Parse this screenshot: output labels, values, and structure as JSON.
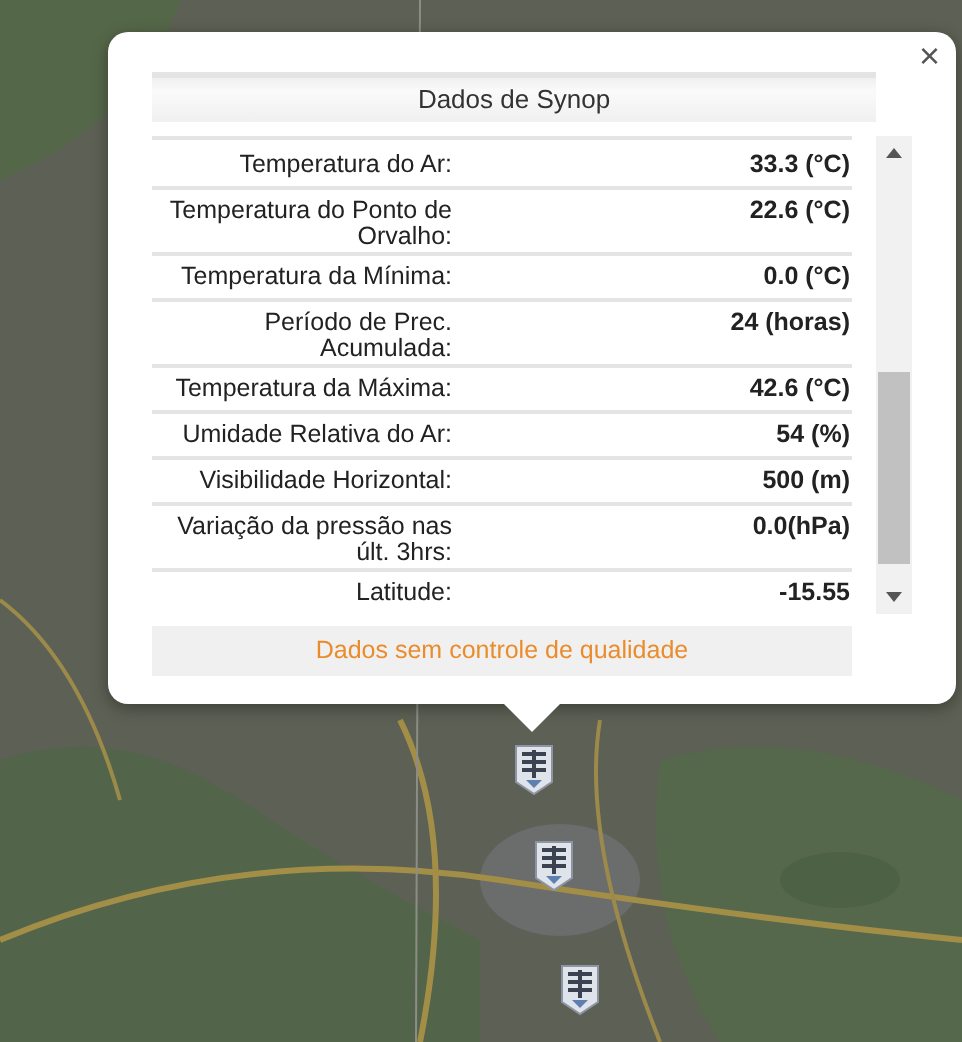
{
  "popup": {
    "close": "×",
    "title": "Dados de Synop",
    "rows": [
      {
        "label": "Temperatura do Ar:",
        "value": "33.3 (°C)"
      },
      {
        "label": "Temperatura do Ponto de Orvalho:",
        "value": "22.6 (°C)"
      },
      {
        "label": "Temperatura da Mínima:",
        "value": "0.0 (°C)"
      },
      {
        "label": "Período de Prec. Acumulada:",
        "value": "24 (horas)"
      },
      {
        "label": "Temperatura da Máxima:",
        "value": "42.6 (°C)"
      },
      {
        "label": "Umidade Relativa do Ar:",
        "value": "54 (%)"
      },
      {
        "label": "Visibilidade Horizontal:",
        "value": "500 (m)"
      },
      {
        "label": "Variação da pressão nas últ. 3hrs:",
        "value": "0.0(hPa)"
      },
      {
        "label": "Latitude:",
        "value": "-15.55"
      }
    ],
    "footer": "Dados sem controle de qualidade"
  }
}
